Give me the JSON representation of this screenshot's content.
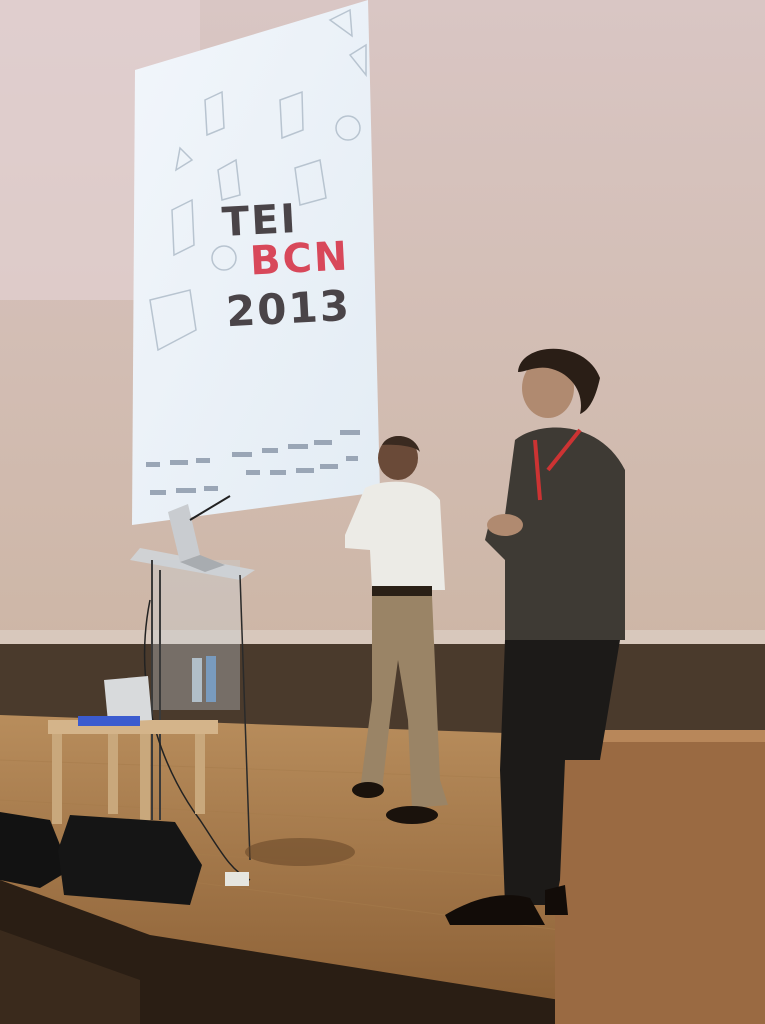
{
  "slide": {
    "line1": "TEI",
    "line2": "BCN",
    "line3": "2013"
  }
}
